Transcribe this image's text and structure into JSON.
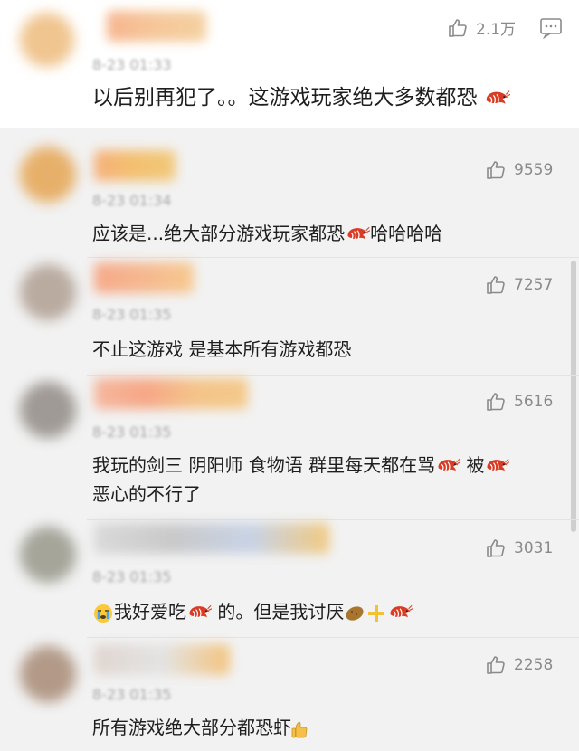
{
  "main_comment": {
    "time": "8-23 01:33",
    "likes": "2.1万",
    "text": "以后别再犯了。。这游戏玩家绝大多数都恐",
    "avatar_color": "#f1c99a"
  },
  "replies": [
    {
      "time": "8-23 01:34",
      "likes": "9559",
      "line1": "应该是...绝大部分游戏玩家都恐",
      "line1_after": "哈哈哈哈",
      "line2": ""
    },
    {
      "time": "8-23 01:35",
      "likes": "7257",
      "line1": "不止这游戏 是基本所有游戏都恐",
      "line1_after": "",
      "line2": ""
    },
    {
      "time": "8-23 01:35",
      "likes": "5616",
      "line1": "我玩的剑三 阴阳师 食物语 群里每天都在骂",
      "line1_mid": "被",
      "line2": "恶心的不行了"
    },
    {
      "time": "8-23 01:35",
      "likes": "3031",
      "line1_a": "我好爱吃",
      "line1_b": "的。但是我讨厌",
      "line2": ""
    },
    {
      "time": "8-23 01:35",
      "likes": "2258",
      "line1": "所有游戏绝大部分都恐虾",
      "line2": ""
    }
  ],
  "colors": {
    "accent": "#e2432b",
    "like_gray": "#8a8a8a"
  },
  "icons": [
    "thumbs-up-icon",
    "reply-bubble-icon",
    "shrimp-icon",
    "crying-face-icon",
    "potato-icon",
    "plus-icon",
    "thumbs-up-hand-icon"
  ]
}
